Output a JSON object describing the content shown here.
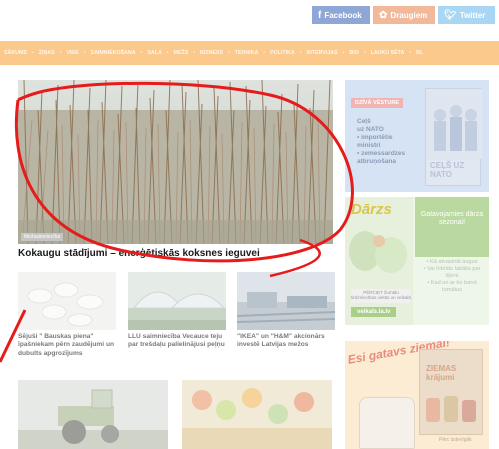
{
  "social": {
    "facebook": "Facebook",
    "draugiem": "Draugiem",
    "twitter": "Twitter",
    "colors": {
      "facebook": "#8fa7d6",
      "draugiem": "#f2b89a",
      "twitter": "#a9d6f2"
    }
  },
  "nav": {
    "items": [
      "SĀKUMS",
      "ZIŅAS",
      "VIDE",
      "SAIMNIEKOŠANA",
      "SALA",
      "MEŽS",
      "BIZNESS",
      "TEHNIKA",
      "POLITIKA",
      "INTERVIJAS",
      "BIO",
      "LAUKU SĒTA",
      "BL"
    ],
    "background": "#fbc98c"
  },
  "hero": {
    "badge": "Mežsaimniecība",
    "title": "Kokaugu stādījumi – enerģētiskās koksnes ieguvei"
  },
  "ad_history": {
    "tag": "DZĪVĀ VĒSTURE",
    "lines": [
      "Ceļš",
      "uz NATO",
      "• importētie",
      "ministri",
      "• zemessardzes",
      "atbruņošana"
    ],
    "book_title": "CEĻŠ UZ NATO"
  },
  "ad_veikals": {
    "logo": "Dārzs",
    "headline": "Gatavojamies dārza sezonai!",
    "bullets": [
      "• Kā atvasināt augus",
      "• Vai hibrīds labāks par šķirni",
      "• Kad un ar ko barot tomātus"
    ],
    "button": "PĒRCIET žurnālu tirdzniecības vietās un veikalā",
    "url": "veikals.la.lv"
  },
  "ad_winter": {
    "slogan": "Esi gatavs ziemai!",
    "book_title": "ZIEMAS krājumi",
    "caption": "Pērc izdevīgāk"
  },
  "articles": [
    {
      "title": "Sējuši \" Bauskas piena\" īpašniekam pērn zaudējumi un dubults apgrozījums"
    },
    {
      "title": "LLU saimniecība Vecauce teju par trešdaļu palielinājusi peļņu"
    },
    {
      "title": "\"IKEA\" un \"H&M\" akcionārs investē Latvijas mežos"
    }
  ]
}
